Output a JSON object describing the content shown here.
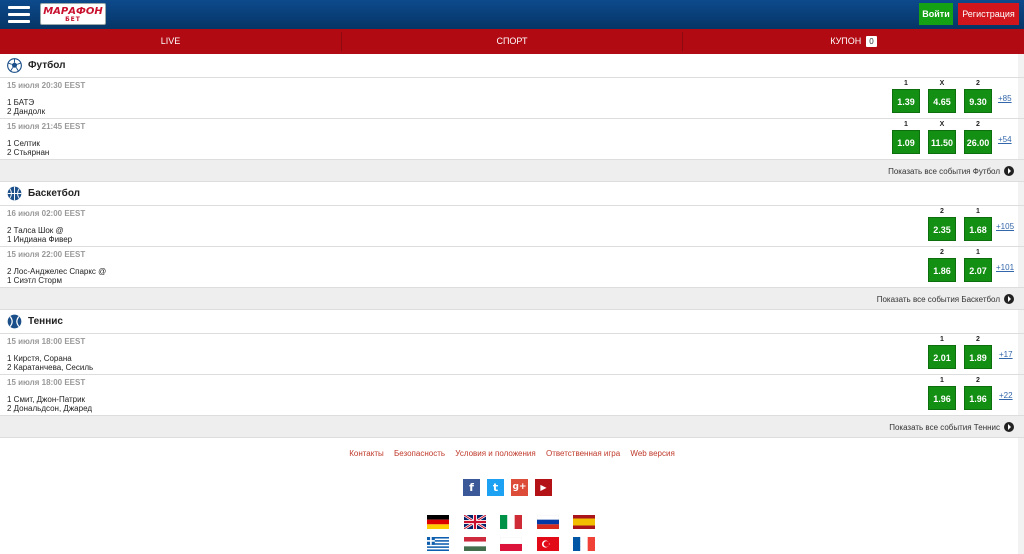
{
  "header": {
    "logo_line1": "МАРАФОН",
    "logo_line2": "БЕТ",
    "login_label": "Войти",
    "register_label": "Регистрация"
  },
  "nav": {
    "live": "LIVE",
    "sport": "СПОРТ",
    "coupon": "КУПОН",
    "coupon_count": "0"
  },
  "sports": [
    {
      "name": "Футбол",
      "show_all": "Показать все события Футбол",
      "events": [
        {
          "date": "15 июля 20:30 EEST",
          "team1": "1 БАТЭ",
          "team2": "2 Дандолк",
          "odds": [
            {
              "label": "1",
              "value": "1.39"
            },
            {
              "label": "X",
              "value": "4.65"
            },
            {
              "label": "2",
              "value": "9.30"
            }
          ],
          "more": "+85"
        },
        {
          "date": "15 июля 21:45 EEST",
          "team1": "1 Селтик",
          "team2": "2 Стьярнан",
          "odds": [
            {
              "label": "1",
              "value": "1.09"
            },
            {
              "label": "X",
              "value": "11.50"
            },
            {
              "label": "2",
              "value": "26.00"
            }
          ],
          "more": "+54"
        }
      ]
    },
    {
      "name": "Баскетбол",
      "show_all": "Показать все события Баскетбол",
      "events": [
        {
          "date": "16 июля 02:00 EEST",
          "team1": "2 Талса Шок @",
          "team2": "1 Индиана Фивер",
          "odds": [
            {
              "label": "2",
              "value": "2.35"
            },
            {
              "label": "1",
              "value": "1.68"
            }
          ],
          "more": "+105"
        },
        {
          "date": "15 июля 22:00 EEST",
          "team1": "2 Лос-Анджелес Спаркс @",
          "team2": "1 Сиэтл Сторм",
          "odds": [
            {
              "label": "2",
              "value": "1.86"
            },
            {
              "label": "1",
              "value": "2.07"
            }
          ],
          "more": "+101"
        }
      ]
    },
    {
      "name": "Теннис",
      "show_all": "Показать все события Теннис",
      "events": [
        {
          "date": "15 июля 18:00 EEST",
          "team1": "1 Кирстя, Сорана",
          "team2": "2 Каратанчева, Сесиль",
          "odds": [
            {
              "label": "1",
              "value": "2.01"
            },
            {
              "label": "2",
              "value": "1.89"
            }
          ],
          "more": "+17"
        },
        {
          "date": "15 июля 18:00 EEST",
          "team1": "1 Смит, Джон-Патрик",
          "team2": "2 Дональдсон, Джаред",
          "odds": [
            {
              "label": "1",
              "value": "1.96"
            },
            {
              "label": "2",
              "value": "1.96"
            }
          ],
          "more": "+22"
        }
      ]
    }
  ],
  "footer": {
    "links": [
      "Контакты",
      "Безопасность",
      "Условия и положения",
      "Ответственная игра",
      "Web версия"
    ],
    "social": [
      {
        "icon": "facebook-icon",
        "glyph": "f",
        "color": "#3b5998"
      },
      {
        "icon": "twitter-icon",
        "glyph": "t",
        "color": "#1da1f2"
      },
      {
        "icon": "google-plus-icon",
        "glyph": "g+",
        "color": "#dd4b39"
      },
      {
        "icon": "youtube-icon",
        "glyph": "▶",
        "color": "#b31217"
      }
    ],
    "flags": [
      "germany-flag-icon",
      "uk-flag-icon",
      "italy-flag-icon",
      "russia-flag-icon",
      "spain-flag-icon",
      "greece-flag-icon",
      "hungary-flag-icon",
      "poland-flag-icon",
      "turkey-flag-icon",
      "france-flag-icon"
    ]
  },
  "colors": {
    "brand_blue": "#0d4a8c",
    "brand_red": "#b10a12",
    "odd_green": "#138f13"
  }
}
